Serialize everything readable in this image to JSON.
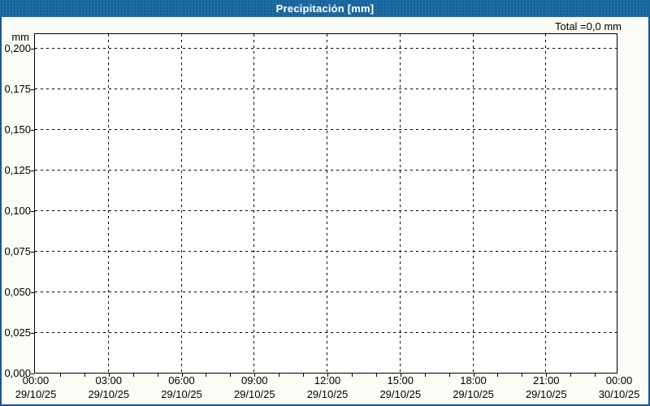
{
  "window": {
    "title": "Precipitación [mm]"
  },
  "summary": {
    "total_label": "Total =0,0 mm"
  },
  "y_axis": {
    "unit": "mm",
    "tick_labels": [
      "0,200",
      "0,175",
      "0,150",
      "0,125",
      "0,100",
      "0,075",
      "0,050",
      "0,025",
      "0,000"
    ]
  },
  "x_axis": {
    "tick_times": [
      "00:00",
      "03:00",
      "06:00",
      "09:00",
      "12:00",
      "15:00",
      "18:00",
      "21:00",
      "00:00"
    ],
    "tick_dates": [
      "29/10/25",
      "29/10/25",
      "29/10/25",
      "29/10/25",
      "29/10/25",
      "29/10/25",
      "29/10/25",
      "29/10/25",
      "30/10/25"
    ]
  },
  "colors": {
    "titlebar": "#1E6CA4",
    "title_text": "#FFFFFF",
    "frame": "#1A5791",
    "background": "#FBFCF5",
    "plot_bg": "#FFFFFF",
    "plot_border": "#000000",
    "grid": "#000000",
    "label_text": "#000000"
  },
  "chart_data": {
    "type": "bar",
    "title": "Precipitación [mm]",
    "xlabel": "",
    "ylabel": "mm",
    "ylim": [
      0,
      0.21
    ],
    "y_tick_values": [
      0,
      0.025,
      0.05,
      0.075,
      0.1,
      0.125,
      0.15,
      0.175,
      0.2
    ],
    "y_tick_step": 0.025,
    "x_range_hours": 24,
    "x_major_every_hours": 3,
    "x_minor_every_hours": 1,
    "x_start": "29/10/25 00:00",
    "x_end": "30/10/25 00:00",
    "grid": true,
    "legend_position": "none",
    "series": [
      {
        "name": "Precipitación",
        "x": [],
        "values": []
      }
    ],
    "total_mm": 0.0,
    "note": "Empty plot — no precipitation recorded over the 24 h window, total 0,0 mm"
  }
}
